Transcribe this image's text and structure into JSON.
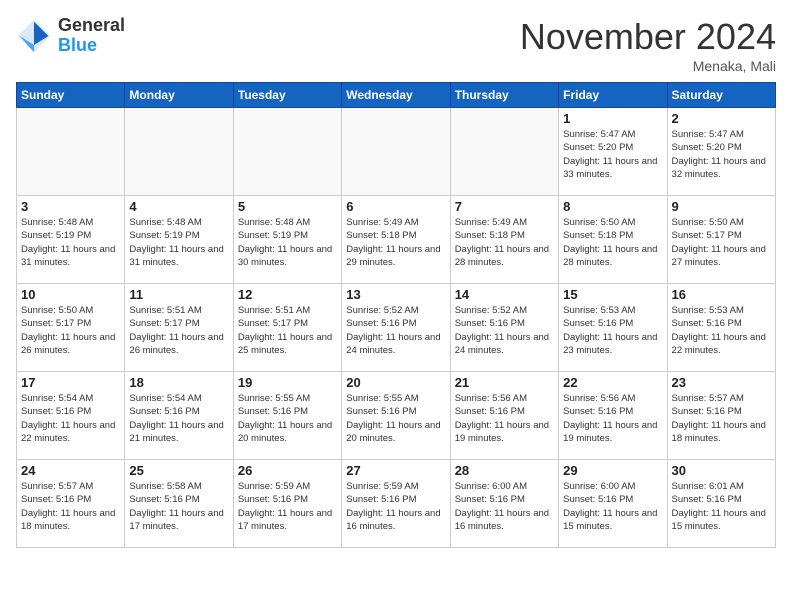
{
  "logo": {
    "general": "General",
    "blue": "Blue"
  },
  "title": "November 2024",
  "location": "Menaka, Mali",
  "days_of_week": [
    "Sunday",
    "Monday",
    "Tuesday",
    "Wednesday",
    "Thursday",
    "Friday",
    "Saturday"
  ],
  "weeks": [
    [
      {
        "day": "",
        "info": ""
      },
      {
        "day": "",
        "info": ""
      },
      {
        "day": "",
        "info": ""
      },
      {
        "day": "",
        "info": ""
      },
      {
        "day": "",
        "info": ""
      },
      {
        "day": "1",
        "info": "Sunrise: 5:47 AM\nSunset: 5:20 PM\nDaylight: 11 hours and 33 minutes."
      },
      {
        "day": "2",
        "info": "Sunrise: 5:47 AM\nSunset: 5:20 PM\nDaylight: 11 hours and 32 minutes."
      }
    ],
    [
      {
        "day": "3",
        "info": "Sunrise: 5:48 AM\nSunset: 5:19 PM\nDaylight: 11 hours and 31 minutes."
      },
      {
        "day": "4",
        "info": "Sunrise: 5:48 AM\nSunset: 5:19 PM\nDaylight: 11 hours and 31 minutes."
      },
      {
        "day": "5",
        "info": "Sunrise: 5:48 AM\nSunset: 5:19 PM\nDaylight: 11 hours and 30 minutes."
      },
      {
        "day": "6",
        "info": "Sunrise: 5:49 AM\nSunset: 5:18 PM\nDaylight: 11 hours and 29 minutes."
      },
      {
        "day": "7",
        "info": "Sunrise: 5:49 AM\nSunset: 5:18 PM\nDaylight: 11 hours and 28 minutes."
      },
      {
        "day": "8",
        "info": "Sunrise: 5:50 AM\nSunset: 5:18 PM\nDaylight: 11 hours and 28 minutes."
      },
      {
        "day": "9",
        "info": "Sunrise: 5:50 AM\nSunset: 5:17 PM\nDaylight: 11 hours and 27 minutes."
      }
    ],
    [
      {
        "day": "10",
        "info": "Sunrise: 5:50 AM\nSunset: 5:17 PM\nDaylight: 11 hours and 26 minutes."
      },
      {
        "day": "11",
        "info": "Sunrise: 5:51 AM\nSunset: 5:17 PM\nDaylight: 11 hours and 26 minutes."
      },
      {
        "day": "12",
        "info": "Sunrise: 5:51 AM\nSunset: 5:17 PM\nDaylight: 11 hours and 25 minutes."
      },
      {
        "day": "13",
        "info": "Sunrise: 5:52 AM\nSunset: 5:16 PM\nDaylight: 11 hours and 24 minutes."
      },
      {
        "day": "14",
        "info": "Sunrise: 5:52 AM\nSunset: 5:16 PM\nDaylight: 11 hours and 24 minutes."
      },
      {
        "day": "15",
        "info": "Sunrise: 5:53 AM\nSunset: 5:16 PM\nDaylight: 11 hours and 23 minutes."
      },
      {
        "day": "16",
        "info": "Sunrise: 5:53 AM\nSunset: 5:16 PM\nDaylight: 11 hours and 22 minutes."
      }
    ],
    [
      {
        "day": "17",
        "info": "Sunrise: 5:54 AM\nSunset: 5:16 PM\nDaylight: 11 hours and 22 minutes."
      },
      {
        "day": "18",
        "info": "Sunrise: 5:54 AM\nSunset: 5:16 PM\nDaylight: 11 hours and 21 minutes."
      },
      {
        "day": "19",
        "info": "Sunrise: 5:55 AM\nSunset: 5:16 PM\nDaylight: 11 hours and 20 minutes."
      },
      {
        "day": "20",
        "info": "Sunrise: 5:55 AM\nSunset: 5:16 PM\nDaylight: 11 hours and 20 minutes."
      },
      {
        "day": "21",
        "info": "Sunrise: 5:56 AM\nSunset: 5:16 PM\nDaylight: 11 hours and 19 minutes."
      },
      {
        "day": "22",
        "info": "Sunrise: 5:56 AM\nSunset: 5:16 PM\nDaylight: 11 hours and 19 minutes."
      },
      {
        "day": "23",
        "info": "Sunrise: 5:57 AM\nSunset: 5:16 PM\nDaylight: 11 hours and 18 minutes."
      }
    ],
    [
      {
        "day": "24",
        "info": "Sunrise: 5:57 AM\nSunset: 5:16 PM\nDaylight: 11 hours and 18 minutes."
      },
      {
        "day": "25",
        "info": "Sunrise: 5:58 AM\nSunset: 5:16 PM\nDaylight: 11 hours and 17 minutes."
      },
      {
        "day": "26",
        "info": "Sunrise: 5:59 AM\nSunset: 5:16 PM\nDaylight: 11 hours and 17 minutes."
      },
      {
        "day": "27",
        "info": "Sunrise: 5:59 AM\nSunset: 5:16 PM\nDaylight: 11 hours and 16 minutes."
      },
      {
        "day": "28",
        "info": "Sunrise: 6:00 AM\nSunset: 5:16 PM\nDaylight: 11 hours and 16 minutes."
      },
      {
        "day": "29",
        "info": "Sunrise: 6:00 AM\nSunset: 5:16 PM\nDaylight: 11 hours and 15 minutes."
      },
      {
        "day": "30",
        "info": "Sunrise: 6:01 AM\nSunset: 5:16 PM\nDaylight: 11 hours and 15 minutes."
      }
    ]
  ]
}
